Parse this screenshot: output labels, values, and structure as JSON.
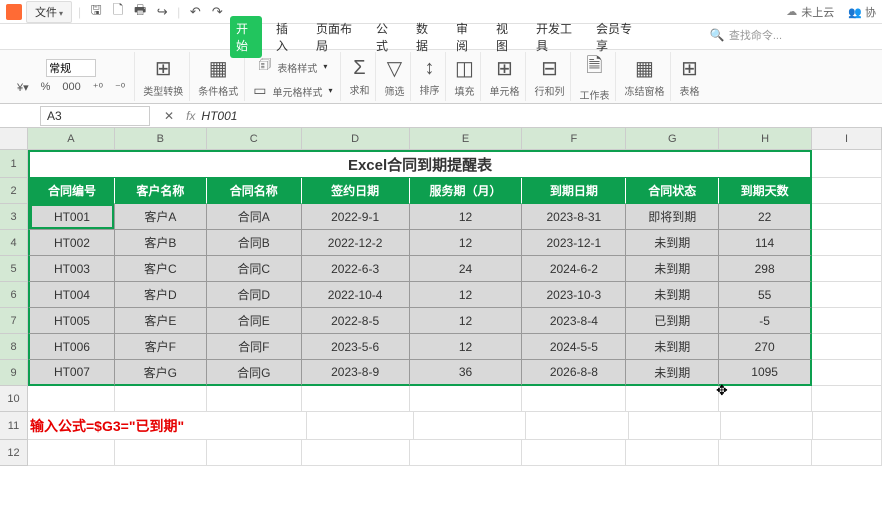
{
  "menubar": {
    "file_label": "文件",
    "search_placeholder": "查找命令...",
    "cloud_status": "未上云",
    "collab_label": "协"
  },
  "tabs": [
    "开始",
    "插入",
    "页面布局",
    "公式",
    "数据",
    "审阅",
    "视图",
    "开发工具",
    "会员专享"
  ],
  "tabs_active_index": 0,
  "ribbon": {
    "format_value": "常规",
    "type_convert": "类型转换",
    "cond_fmt": "条件格式",
    "table_style": "表格样式",
    "cell_style": "单元格样式",
    "sum": "求和",
    "filter": "筛选",
    "sort": "排序",
    "fill": "填充",
    "cells": "单元格",
    "rowcol": "行和列",
    "sheet": "工作表",
    "freeze": "冻结窗格",
    "tablefmt": "表格"
  },
  "name_box": "A3",
  "formula_value": "HT001",
  "col_letters": [
    "A",
    "B",
    "C",
    "D",
    "E",
    "F",
    "G",
    "H",
    "I"
  ],
  "row_numbers": [
    "1",
    "2",
    "3",
    "4",
    "5",
    "6",
    "7",
    "8",
    "9",
    "10",
    "11",
    "12"
  ],
  "table": {
    "title": "Excel合同到期提醒表",
    "headers": [
      "合同编号",
      "客户名称",
      "合同名称",
      "签约日期",
      "服务期（月）",
      "到期日期",
      "合同状态",
      "到期天数"
    ],
    "rows": [
      [
        "HT001",
        "客户A",
        "合同A",
        "2022-9-1",
        "12",
        "2023-8-31",
        "即将到期",
        "22"
      ],
      [
        "HT002",
        "客户B",
        "合同B",
        "2022-12-2",
        "12",
        "2023-12-1",
        "未到期",
        "114"
      ],
      [
        "HT003",
        "客户C",
        "合同C",
        "2022-6-3",
        "24",
        "2024-6-2",
        "未到期",
        "298"
      ],
      [
        "HT004",
        "客户D",
        "合同D",
        "2022-10-4",
        "12",
        "2023-10-3",
        "未到期",
        "55"
      ],
      [
        "HT005",
        "客户E",
        "合同E",
        "2022-8-5",
        "12",
        "2023-8-4",
        "已到期",
        "-5"
      ],
      [
        "HT006",
        "客户F",
        "合同F",
        "2023-5-6",
        "12",
        "2024-5-5",
        "未到期",
        "270"
      ],
      [
        "HT007",
        "客户G",
        "合同G",
        "2023-8-9",
        "36",
        "2026-8-8",
        "未到期",
        "1095"
      ]
    ]
  },
  "note_text": "输入公式=$G3=\"已到期\""
}
